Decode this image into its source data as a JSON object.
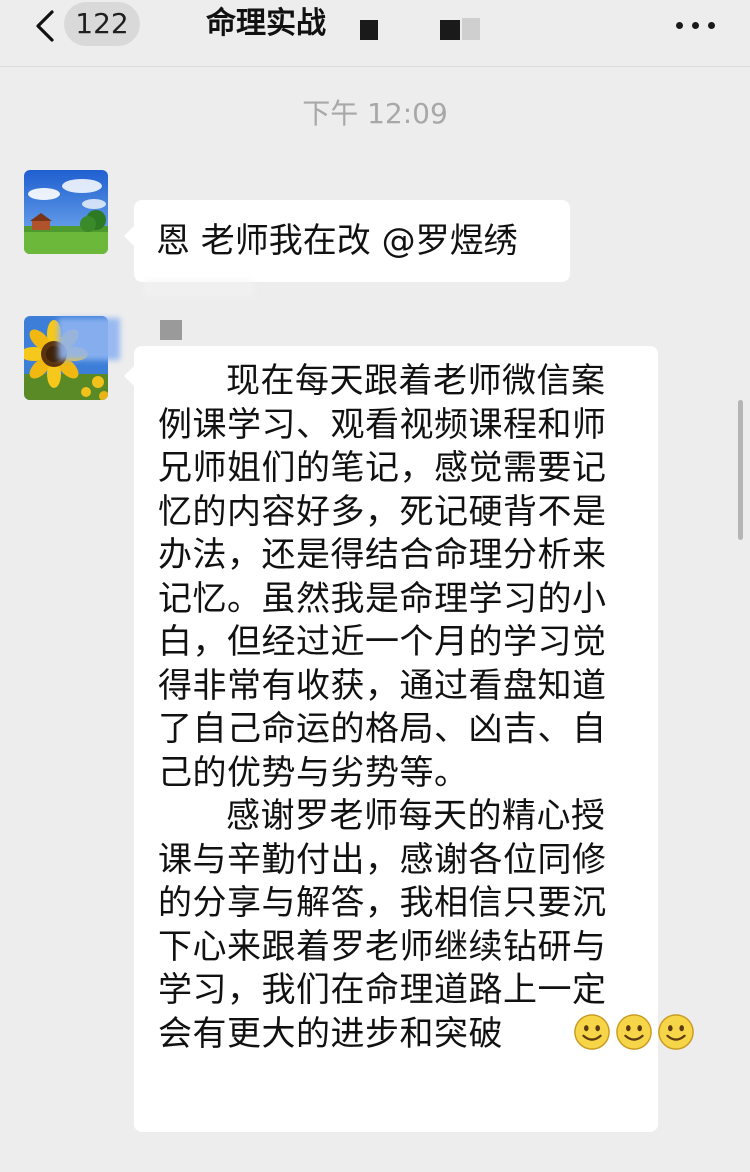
{
  "header": {
    "back_icon": "chevron-left-icon",
    "unread_count": "122",
    "title": "命理实战",
    "more_icon": "more-horizontal-icon"
  },
  "timestamp": "下午 12:09",
  "messages": [
    {
      "avatar_icon": "landscape-avatar",
      "text": "恩 老师我在改 @罗煜绣"
    },
    {
      "avatar_icon": "sunflower-avatar",
      "paragraphs": [
        "现在每天跟着老师微信案例课学习、观看视频课程和师兄师姐们的笔记，感觉需要记忆的内容好多，死记硬背不是办法，还是得结合命理分析来记忆。虽然我是命理学习的小白，但经过近一个月的学习觉得非常有收获，通过看盘知道了自己命运的格局、凶吉、自己的优势与劣势等。",
        "感谢罗老师每天的精心授课与辛勤付出，感谢各位同修的分享与解答，我相信只要沉下心来跟着罗老师继续钻研与学习，我们在命理道路上一定会有更大的进步和突破"
      ],
      "emoji_icon": "smile-emoji-icon",
      "emoji_count": 3
    }
  ],
  "colors": {
    "background": "#ededed",
    "bubble": "#ffffff",
    "timestamp": "#a8a8a8"
  }
}
